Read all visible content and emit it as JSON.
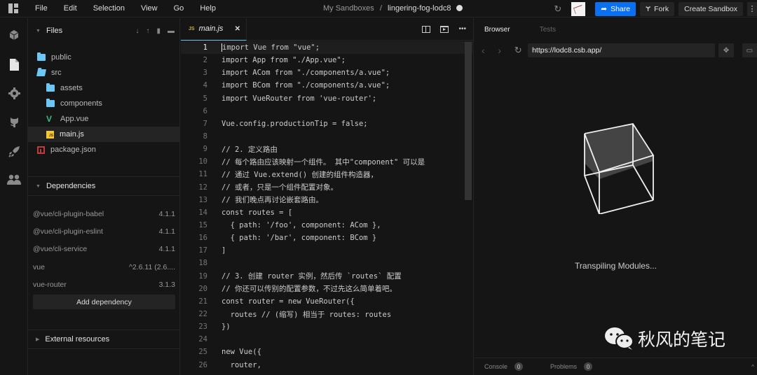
{
  "menu": [
    "File",
    "Edit",
    "Selection",
    "View",
    "Go",
    "Help"
  ],
  "breadcrumb": {
    "parent": "My Sandboxes",
    "separator": "/",
    "name": "lingering-fog-lodc8"
  },
  "toolbar": {
    "share_label": "Share",
    "fork_label": "Fork",
    "create_label": "Create Sandbox",
    "more_glyph": "⋮",
    "refresh_glyph": "↻"
  },
  "activity_icons": [
    "cube-icon",
    "file-icon",
    "gear-icon",
    "github-icon",
    "rocket-icon",
    "users-icon"
  ],
  "files": {
    "title": "Files",
    "tree": [
      {
        "name": "public",
        "type": "folder",
        "depth": 0
      },
      {
        "name": "src",
        "type": "folder-open",
        "depth": 0
      },
      {
        "name": "assets",
        "type": "folder",
        "depth": 1
      },
      {
        "name": "components",
        "type": "folder",
        "depth": 1
      },
      {
        "name": "App.vue",
        "type": "vue",
        "depth": 1
      },
      {
        "name": "main.js",
        "type": "js",
        "depth": 1,
        "active": true
      },
      {
        "name": "package.json",
        "type": "npm",
        "depth": 0
      }
    ]
  },
  "dependencies": {
    "title": "Dependencies",
    "items": [
      {
        "name": "@vue/cli-plugin-babel",
        "version": "4.1.1"
      },
      {
        "name": "@vue/cli-plugin-eslint",
        "version": "4.1.1"
      },
      {
        "name": "@vue/cli-service",
        "version": "4.1.1"
      },
      {
        "name": "vue",
        "version": "^2.6.11 (2.6...."
      },
      {
        "name": "vue-router",
        "version": "3.1.3"
      }
    ],
    "add_label": "Add dependency"
  },
  "external": {
    "title": "External resources"
  },
  "editor": {
    "tab": {
      "badge": "JS",
      "name": "main.js",
      "close": "✕"
    },
    "more_glyph": "•••",
    "current_line": 1,
    "lines": [
      "import Vue from \"vue\";",
      "import App from \"./App.vue\";",
      "import ACom from \"./components/a.vue\";",
      "import BCom from \"./components/a.vue\";",
      "import VueRouter from 'vue-router';",
      "",
      "Vue.config.productionTip = false;",
      "",
      "// 2. 定义路由",
      "// 每个路由应该映射一个组件。 其中\"component\" 可以是",
      "// 通过 Vue.extend() 创建的组件构造器，",
      "// 或者，只是一个组件配置对象。",
      "// 我们晚点再讨论嵌套路由。",
      "const routes = [",
      "  { path: '/foo', component: ACom },",
      "  { path: '/bar', component: BCom }",
      "]",
      "",
      "// 3. 创建 router 实例，然后传 `routes` 配置",
      "// 你还可以传别的配置参数，不过先这么简单着吧。",
      "const router = new VueRouter({",
      "  routes // (缩写) 相当于 routes: routes",
      "})",
      "",
      "new Vue({",
      "  router,"
    ]
  },
  "browser": {
    "tabs": [
      "Browser",
      "Tests"
    ],
    "url": "https://lodc8.csb.app/",
    "back_glyph": "‹",
    "forward_glyph": "›",
    "reload_glyph": "↻",
    "status": "Transpiling Modules...",
    "watermark": "秋风的笔记",
    "console": {
      "label": "Console",
      "count": "0"
    },
    "problems": {
      "label": "Problems",
      "count": "0"
    },
    "chevron": "^"
  }
}
